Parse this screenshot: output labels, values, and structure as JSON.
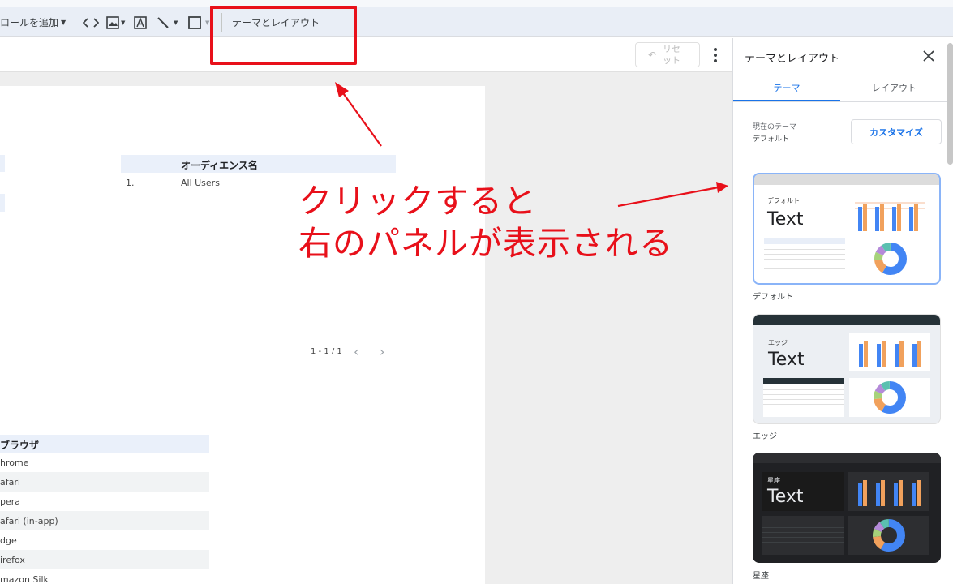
{
  "toolbar": {
    "add_control": "ロールを追加",
    "theme_layout_button": "テーマとレイアウト",
    "code_icon": "code-icon",
    "image_icon": "image-icon",
    "text_icon": "text-icon",
    "line_icon": "line-icon",
    "shape_icon": "rectangle-icon"
  },
  "subbar": {
    "reset_label": "リセット"
  },
  "report": {
    "audience_table": {
      "header": "オーディエンス名",
      "rows": [
        {
          "index": "1.",
          "name": "All Users"
        }
      ]
    },
    "pagination": "1 - 1 / 1",
    "browser_table": {
      "header": "ブラウザ",
      "rows": [
        "hrome",
        "afari",
        "pera",
        "afari (in-app)",
        "dge",
        "irefox",
        "mazon Silk"
      ]
    }
  },
  "annotation": {
    "line1": "クリックすると",
    "line2": "右のパネルが表示される",
    "color": "#e8101a"
  },
  "panel": {
    "title": "テーマとレイアウト",
    "tabs": [
      {
        "label": "テーマ",
        "active": true
      },
      {
        "label": "レイアウト",
        "active": false
      }
    ],
    "current_theme_label": "現在のテーマ",
    "current_theme_value": "デフォルト",
    "customize_button": "カスタマイズ",
    "themes": [
      {
        "name": "デフォルト",
        "card_title": "デフォルト",
        "sample": "Text",
        "style": "light",
        "selected": true
      },
      {
        "name": "エッジ",
        "card_title": "エッジ",
        "sample": "Text",
        "style": "edge",
        "selected": false
      },
      {
        "name": "星座",
        "card_title": "星座",
        "sample": "Text",
        "style": "dark",
        "selected": false
      }
    ]
  },
  "colors": {
    "accent": "#1a73e8",
    "bar_blue": "#4285f4",
    "bar_orange": "#f1a15c"
  }
}
